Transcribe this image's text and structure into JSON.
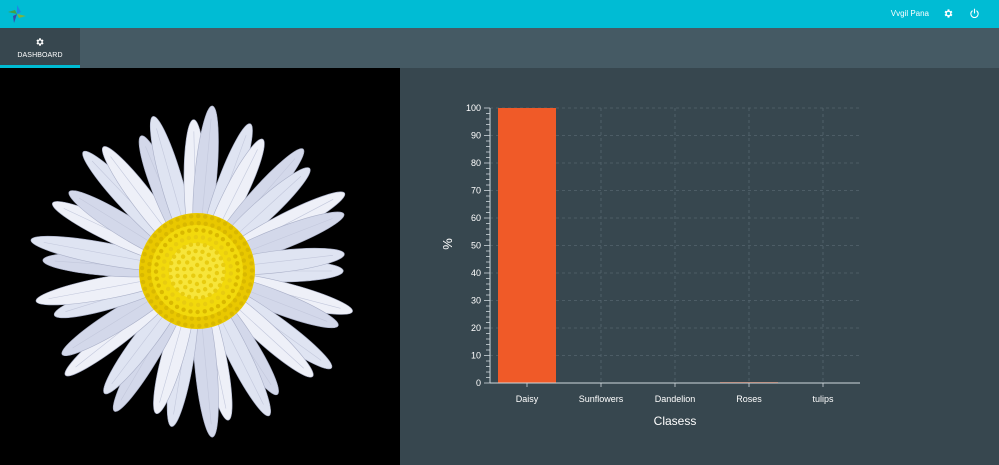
{
  "header": {
    "user_name": "Vvgil Pana",
    "logo_icon": "pinwheel-logo-icon",
    "settings_icon": "gear-icon",
    "logout_icon": "power-icon"
  },
  "nav": {
    "tabs": [
      {
        "label": "DASHBOARD",
        "icon": "gear-icon",
        "active": true
      }
    ]
  },
  "image_panel": {
    "subject": "daisy flower"
  },
  "chart_data": {
    "type": "bar",
    "categories": [
      "Daisy",
      "Sunflowers",
      "Dandelion",
      "Roses",
      "tulips"
    ],
    "values": [
      100,
      0,
      0,
      0.3,
      0
    ],
    "xlabel": "Clasess",
    "ylabel": "%",
    "ylim": [
      0,
      100
    ],
    "yticks": [
      0,
      10,
      20,
      30,
      40,
      50,
      60,
      70,
      80,
      90,
      100
    ],
    "grid": true,
    "bar_color": "#f05a28"
  },
  "colors": {
    "accent": "#00bcd4",
    "panel": "#37474f",
    "subbar": "#455a64",
    "bar": "#f05a28"
  }
}
